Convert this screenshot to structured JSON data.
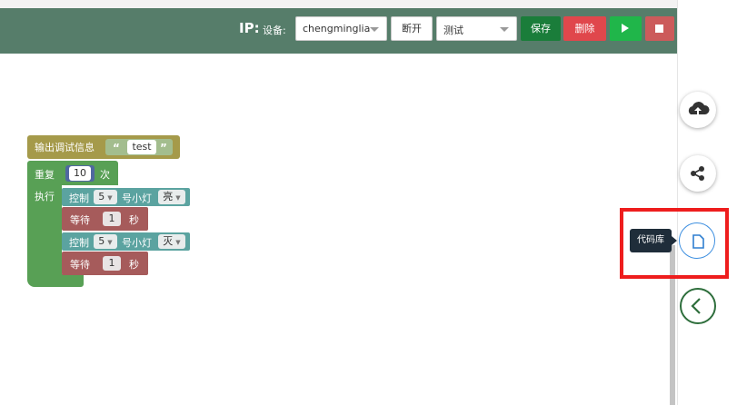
{
  "toolbar": {
    "ip_label": "IP:",
    "device_label": "设备:",
    "device_value": "chengminglia",
    "disconnect_label": "断开",
    "mode_value": "测试",
    "save_label": "保存",
    "delete_label": "删除"
  },
  "colors": {
    "toolbar_bg": "#567d6a",
    "save": "#1a7d3a",
    "delete": "#e0474c",
    "run": "#20b64a",
    "stop": "#cc5b5b",
    "highlight": "#ee1d1d"
  },
  "sidebar": {
    "buttons": [
      {
        "icon": "cloud-upload-icon"
      },
      {
        "icon": "share-icon"
      },
      {
        "icon": "document-icon"
      },
      {
        "icon": "chevron-left-icon"
      }
    ],
    "tooltip": "代码库"
  },
  "blocks": {
    "print": {
      "label": "输出调试信息",
      "value": "test"
    },
    "repeat": {
      "label": "重复",
      "count": "10",
      "unit": "次",
      "do_label": "执行"
    },
    "body": [
      {
        "type": "control",
        "label": "控制",
        "pin": "5",
        "mid": "号小灯",
        "state": "亮"
      },
      {
        "type": "wait",
        "label": "等待",
        "value": "1",
        "unit": "秒"
      },
      {
        "type": "control",
        "label": "控制",
        "pin": "5",
        "mid": "号小灯",
        "state": "灭"
      },
      {
        "type": "wait",
        "label": "等待",
        "value": "1",
        "unit": "秒"
      }
    ]
  }
}
